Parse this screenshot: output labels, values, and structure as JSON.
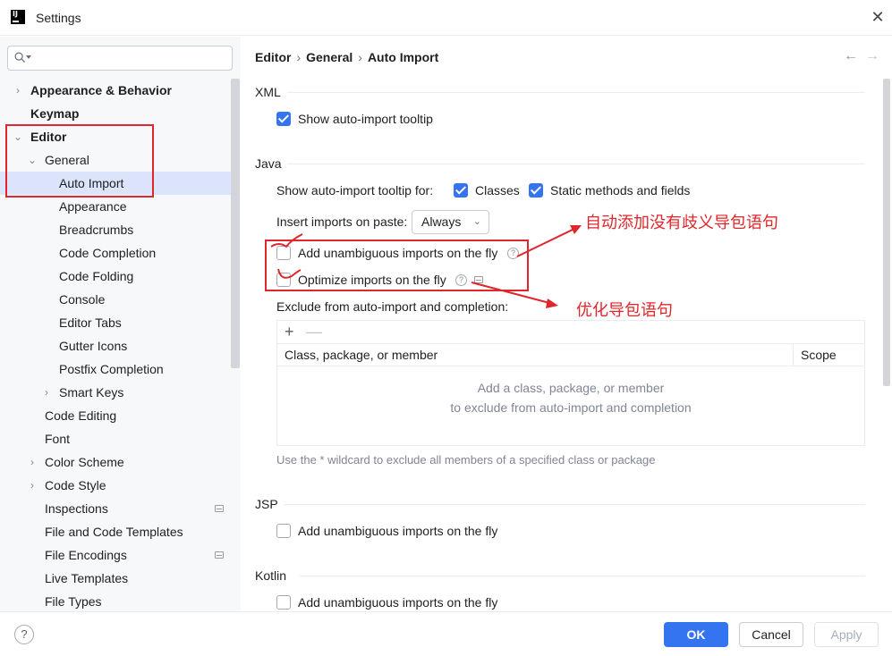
{
  "window": {
    "title": "Settings",
    "logo_text": "IJ"
  },
  "search": {
    "placeholder": ""
  },
  "sidebar": {
    "items": [
      {
        "label": "Appearance & Behavior",
        "bold": true,
        "chevron": "›"
      },
      {
        "label": "Keymap",
        "bold": true
      },
      {
        "label": "Editor",
        "bold": true,
        "chevron": "⌄"
      },
      {
        "label": "General",
        "chevron": "⌄"
      },
      {
        "label": "Auto Import",
        "selected": true
      },
      {
        "label": "Appearance"
      },
      {
        "label": "Breadcrumbs"
      },
      {
        "label": "Code Completion"
      },
      {
        "label": "Code Folding"
      },
      {
        "label": "Console"
      },
      {
        "label": "Editor Tabs"
      },
      {
        "label": "Gutter Icons"
      },
      {
        "label": "Postfix Completion"
      },
      {
        "label": "Smart Keys",
        "chevron": "›"
      },
      {
        "label": "Code Editing"
      },
      {
        "label": "Font"
      },
      {
        "label": "Color Scheme",
        "chevron": "›"
      },
      {
        "label": "Code Style",
        "chevron": "›"
      },
      {
        "label": "Inspections",
        "marker": true
      },
      {
        "label": "File and Code Templates"
      },
      {
        "label": "File Encodings",
        "marker": true
      },
      {
        "label": "Live Templates"
      },
      {
        "label": "File Types"
      }
    ]
  },
  "breadcrumb": {
    "part1": "Editor",
    "part2": "General",
    "part3": "Auto Import",
    "sep": "›"
  },
  "nav": {
    "back": "←",
    "forward": "→"
  },
  "xml": {
    "heading": "XML",
    "show_tooltip": {
      "label": "Show auto-import tooltip",
      "checked": true
    }
  },
  "java": {
    "heading": "Java",
    "tooltip_for_label": "Show auto-import tooltip for:",
    "classes": {
      "label": "Classes",
      "checked": true
    },
    "static_methods": {
      "label": "Static methods and fields",
      "checked": true
    },
    "insert_on_paste_label": "Insert imports on paste:",
    "insert_on_paste_value": "Always",
    "add_unambiguous": {
      "label": "Add unambiguous imports on the fly",
      "checked": false
    },
    "optimize": {
      "label": "Optimize imports on the fly",
      "checked": false
    },
    "exclude_label": "Exclude from auto-import and completion:",
    "table": {
      "col1": "Class, package, or member",
      "col2": "Scope",
      "empty_line1": "Add a class, package, or member",
      "empty_line2": "to exclude from auto-import and completion",
      "add": "+",
      "remove": "—"
    },
    "hint": "Use the * wildcard to exclude all members of a specified class or package"
  },
  "jsp": {
    "heading": "JSP",
    "add_unambiguous": {
      "label": "Add unambiguous imports on the fly",
      "checked": false
    }
  },
  "kotlin": {
    "heading": "Kotlin",
    "add_unambiguous": {
      "label": "Add unambiguous imports on the fly",
      "checked": false
    }
  },
  "annotations": {
    "note1": "自动添加没有歧义导包语句",
    "note2": "优化导包语句",
    "color": "#e0262b"
  },
  "footer": {
    "help": "?",
    "ok": "OK",
    "cancel": "Cancel",
    "apply": "Apply"
  },
  "colors": {
    "accent": "#3574f0",
    "selection": "#dbe4fb",
    "sidebar_bg": "#f7f8fa"
  }
}
